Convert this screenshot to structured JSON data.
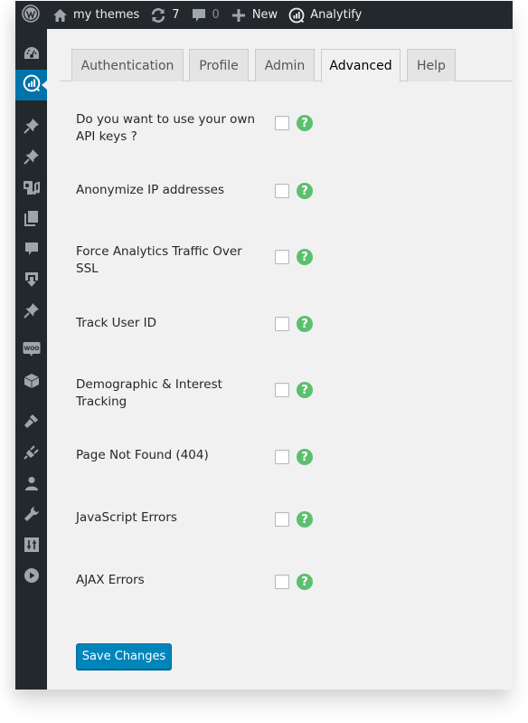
{
  "adminbar": {
    "site_name": "my themes",
    "updates_count": "7",
    "comments_count": "0",
    "new_label": "New",
    "plugin_label": "Analytify"
  },
  "sidebar": {
    "items": [
      {
        "icon": "dashboard-icon"
      },
      {
        "icon": "analytify-icon",
        "active": true
      },
      {
        "icon": "pin-icon"
      },
      {
        "icon": "pin-icon"
      },
      {
        "icon": "media-icon"
      },
      {
        "icon": "pages-icon"
      },
      {
        "icon": "comments-icon"
      },
      {
        "icon": "download-icon"
      },
      {
        "icon": "pin-icon"
      },
      {
        "icon": "woocommerce-icon",
        "label": "WOO"
      },
      {
        "icon": "products-icon"
      },
      {
        "icon": "appearance-icon"
      },
      {
        "icon": "plugins-icon"
      },
      {
        "icon": "users-icon"
      },
      {
        "icon": "tools-icon"
      },
      {
        "icon": "settings-icon"
      },
      {
        "icon": "play-icon"
      }
    ]
  },
  "tabs": [
    {
      "label": "Authentication",
      "active": false
    },
    {
      "label": "Profile",
      "active": false
    },
    {
      "label": "Admin",
      "active": false
    },
    {
      "label": "Advanced",
      "active": true
    },
    {
      "label": "Help",
      "active": false
    }
  ],
  "settings": [
    {
      "label": "Do you want to use your own API keys ?",
      "checked": false
    },
    {
      "label": "Anonymize IP addresses",
      "checked": false
    },
    {
      "label": "Force Analytics Traffic Over SSL",
      "checked": false
    },
    {
      "label": "Track User ID",
      "checked": false
    },
    {
      "label": "Demographic & Interest Tracking",
      "checked": false
    },
    {
      "label": "Page Not Found (404)",
      "checked": false
    },
    {
      "label": "JavaScript Errors",
      "checked": false
    },
    {
      "label": "AJAX Errors",
      "checked": false
    }
  ],
  "help_glyph": "?",
  "save_label": "Save Changes",
  "colors": {
    "adminbar_bg": "#23282d",
    "active_menu": "#0073aa",
    "help_green": "#5cbf6f",
    "primary_button": "#0085ba",
    "content_bg": "#f1f1f1"
  }
}
